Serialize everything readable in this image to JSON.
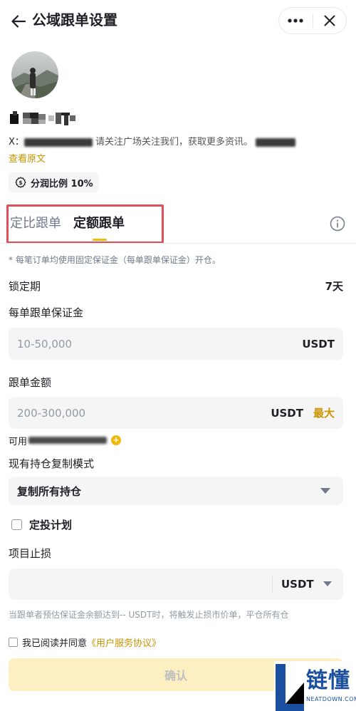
{
  "header": {
    "title": "公域跟单设置"
  },
  "profile": {
    "bio_prefix": "X：",
    "bio_visible": "请关注广场关注我们，获取更多资讯。",
    "view_original": "查看原文",
    "profit_share": "分润比例 10%"
  },
  "tabs": [
    {
      "label": "定比跟单",
      "active": false
    },
    {
      "label": "定额跟单",
      "active": true
    }
  ],
  "form": {
    "note": "* 每笔订单均使用固定保证金（每单跟单保证金）开仓。",
    "lock_period_label": "锁定期",
    "lock_period_value": "7天",
    "margin_label": "每单跟单保证金",
    "margin_placeholder": "10-50,000",
    "margin_unit": "USDT",
    "amount_label": "跟单金额",
    "amount_placeholder": "200-300,000",
    "amount_unit": "USDT",
    "amount_max": "最大",
    "available_label": "可用",
    "copy_mode_label": "现有持仓复制模式",
    "copy_mode_value": "复制所有持仓",
    "dca_label": "定投计划",
    "stop_loss_label": "项目止损",
    "stop_loss_unit": "USDT",
    "stop_loss_note": "当跟单者预估保证金余额达到-- USDT时，将触发止损市价单，平仓所有仓",
    "agree_prefix": "我已阅读并同意",
    "agree_link": "《用户服务协议》",
    "confirm": "确认"
  },
  "watermark": {
    "text": "链懂",
    "sub": "NEATDOWN.COM"
  },
  "colors": {
    "accent": "#f0b90b",
    "link": "#c99400",
    "highlight": "#e0505a",
    "wm": "#1a4fa0"
  }
}
